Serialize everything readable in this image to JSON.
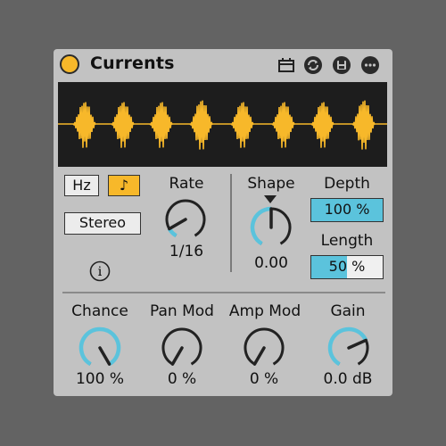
{
  "device": {
    "title": "Currents",
    "colors": {
      "accent": "#f7b82a",
      "mod": "#5bc3dc",
      "panel": "#c2c2c2",
      "display": "#1d1d1d"
    },
    "header_icons": [
      "calendar-icon",
      "sync-icon",
      "save-icon",
      "more-icon"
    ]
  },
  "controls": {
    "hz_label": "Hz",
    "note_label": "♪",
    "stereo_label": "Stereo",
    "info_label": "i",
    "rate": {
      "label": "Rate",
      "value": "1/16",
      "level": 0.1
    },
    "shape": {
      "label": "Shape",
      "value": "0.00",
      "level": 0.5
    },
    "depth": {
      "label": "Depth",
      "value": "100 %",
      "level": 1.0
    },
    "length": {
      "label": "Length",
      "value": "50 %",
      "level": 0.5
    }
  },
  "bottom": {
    "chance": {
      "label": "Chance",
      "value": "100 %",
      "level": 1.0
    },
    "panmod": {
      "label": "Pan Mod",
      "value": "0 %",
      "level": 0.0
    },
    "ampmod": {
      "label": "Amp Mod",
      "value": "0 %",
      "level": 0.0
    },
    "gain": {
      "label": "Gain",
      "value": "0.0 dB",
      "level": 0.72
    }
  }
}
